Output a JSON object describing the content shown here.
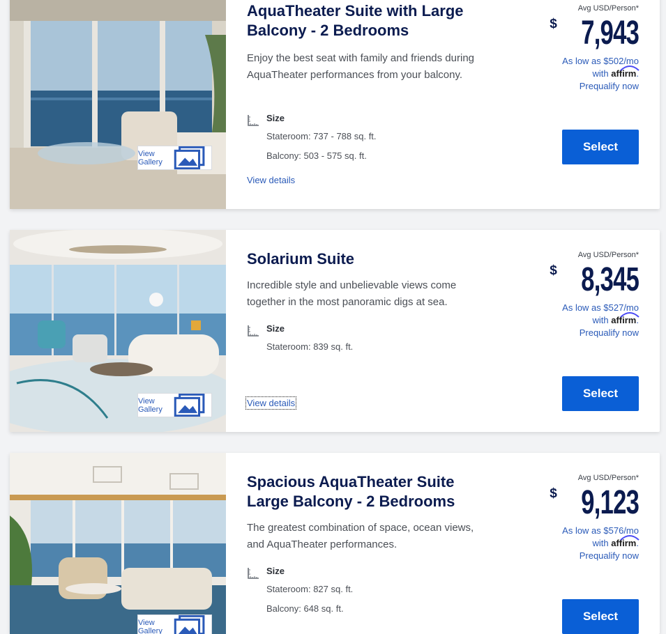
{
  "common": {
    "view_gallery": "View Gallery",
    "size_label": "Size",
    "view_details": "View details",
    "avg_label": "Avg USD/Person*",
    "currency_symbol": "$",
    "with_text": "with",
    "affirm_brand": "affirm",
    "prequalify": "Prequalify now",
    "select_label": "Select"
  },
  "rooms": [
    {
      "title": "AquaTheater Suite with Large Balcony - 2 Bedrooms",
      "description": "Enjoy the best seat with family and friends during AquaTheater performances from your balcony.",
      "stateroom": "Stateroom: 737 - 788 sq. ft.",
      "balcony": "Balcony: 503 - 575 sq. ft.",
      "price": "7,943",
      "monthly": "As low as $502/mo"
    },
    {
      "title": "Solarium Suite",
      "description": "Incredible style and unbelievable views come together in the most panoramic digs at sea.",
      "stateroom": "Stateroom: 839 sq. ft.",
      "price": "8,345",
      "monthly": "As low as $527/mo"
    },
    {
      "title": "Spacious AquaTheater Suite Large Balcony - 2 Bedrooms",
      "description": "The greatest combination of space, ocean views, and AquaTheater performances.",
      "stateroom": "Stateroom: 827 sq. ft.",
      "balcony": "Balcony: 648 sq. ft.",
      "price": "9,123",
      "monthly": "As low as $576/mo"
    }
  ],
  "colors": {
    "title": "#0b1b4f",
    "link": "#2a5ab8",
    "button": "#0a5fd6",
    "background": "#f2f3f5"
  },
  "icons": [
    "gallery-icon",
    "size-ruler-icon",
    "affirm-logo"
  ]
}
